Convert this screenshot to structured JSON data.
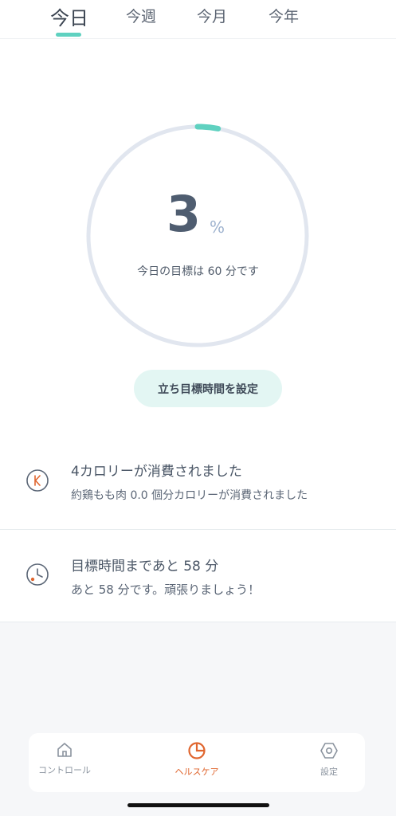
{
  "tabs": [
    {
      "label": "今日",
      "active": true
    },
    {
      "label": "今週",
      "active": false
    },
    {
      "label": "今月",
      "active": false
    },
    {
      "label": "今年",
      "active": false
    }
  ],
  "progress": {
    "value": "3",
    "unit": "%",
    "fraction": 0.03,
    "goal_text": "今日の目標は 60 分です",
    "accent_color": "#5fd1c0",
    "track_color": "#e1e6ef"
  },
  "set_goal_button": "立ち目標時間を設定",
  "cards": [
    {
      "icon": "kcal-icon",
      "title": "4カロリーが消費されました",
      "subtitle": "約鶏もも肉 0.0 個分カロリーが消費されました"
    },
    {
      "icon": "clock-icon",
      "title": "目標時間まであと 58 分",
      "subtitle": "あと 58 分です。頑張りましょう！"
    }
  ],
  "bottom_nav": [
    {
      "label": "コントロール",
      "icon": "home-icon",
      "active": false
    },
    {
      "label": "ヘルスケア",
      "icon": "health-pie-icon",
      "active": true
    },
    {
      "label": "設定",
      "icon": "settings-hexagon-icon",
      "active": false
    }
  ],
  "colors": {
    "active_nav": "#e0662f",
    "card_icon_accent": "#e0662f"
  }
}
